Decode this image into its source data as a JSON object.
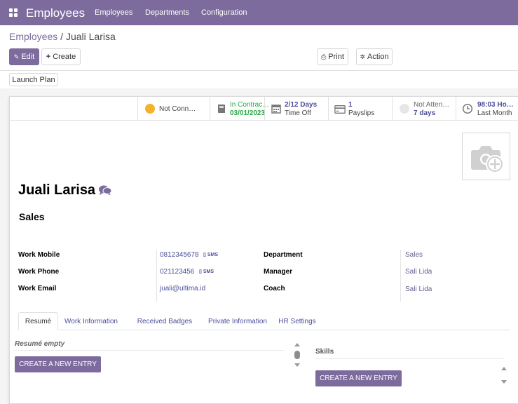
{
  "topbar": {
    "app_title": "Employees",
    "menu": [
      "Employees",
      "Departments",
      "Configuration"
    ]
  },
  "breadcrumb": {
    "parent": "Employees",
    "separator": " / ",
    "current": "Juali Larisa"
  },
  "actions": {
    "edit": "Edit",
    "create": "Create",
    "print": "Print",
    "action": "Action",
    "launch_plan": "Launch Plan"
  },
  "stat_buttons": [
    {
      "text": "Not Conn…"
    },
    {
      "line1": "In Contrac…",
      "line2": "03/01/2023"
    },
    {
      "line1": "2/12 Days",
      "line2": "Time Off"
    },
    {
      "line1": "1",
      "line2": "Payslips"
    },
    {
      "line1": "Not Atten…",
      "line2": "7 days"
    },
    {
      "line1": "98:03 Ho…",
      "line2": "Last Month"
    }
  ],
  "employee": {
    "name": "Juali Larisa",
    "job_title": "Sales"
  },
  "fields": {
    "work_mobile_label": "Work Mobile",
    "work_mobile": "0812345678",
    "work_phone_label": "Work Phone",
    "work_phone": "021123456",
    "work_email_label": "Work Email",
    "work_email": "juali@ultima.id",
    "sms": "SMS",
    "department_label": "Department",
    "department": "Sales",
    "manager_label": "Manager",
    "manager": "Sali Lida",
    "coach_label": "Coach",
    "coach": "Sali Lida"
  },
  "tabs": [
    "Resumé",
    "Work Information",
    "Received Badges",
    "Private Information",
    "HR Settings"
  ],
  "resume": {
    "empty_label": "Resumé empty",
    "create_label": "CREATE A NEW ENTRY"
  },
  "skills": {
    "title": "Skills",
    "create_label": "CREATE A NEW ENTRY"
  },
  "colors": {
    "brand": "#7c6b9c",
    "link": "#4b4e9a",
    "green": "#28a745",
    "yellow": "#f6b12b"
  }
}
